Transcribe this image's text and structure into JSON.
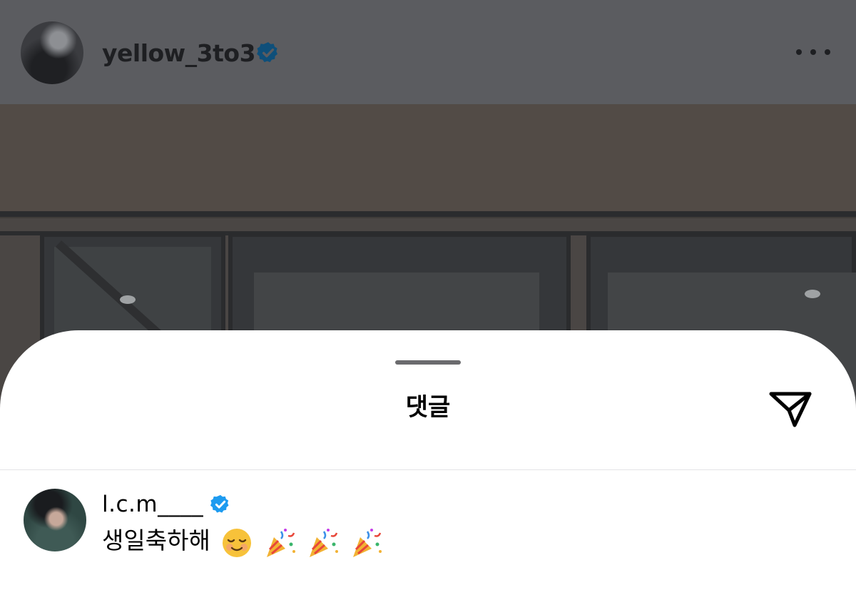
{
  "post": {
    "username": "yellow_3to3",
    "verified_icon": "verified-badge-icon",
    "more_icon": "more-options-icon"
  },
  "comments_sheet": {
    "title": "댓글",
    "share_icon": "send-icon",
    "comments": [
      {
        "username": "l.c.m____",
        "verified": true,
        "text": "생일축하해",
        "emojis": [
          "smiling-face-emoji",
          "party-popper-emoji",
          "party-popper-emoji",
          "party-popper-emoji"
        ]
      }
    ]
  },
  "colors": {
    "verified_blue": "#1d9bf0",
    "dim_overlay": "#5b5c60"
  }
}
